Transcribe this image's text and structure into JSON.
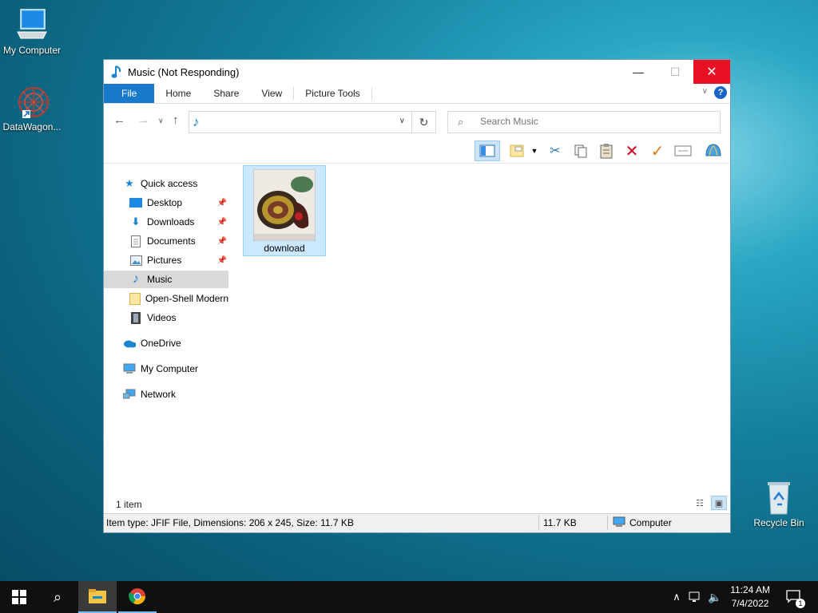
{
  "desktop": {
    "icons": [
      {
        "label": "My Computer"
      },
      {
        "label": "DataWagon..."
      },
      {
        "label": "Recycle Bin"
      }
    ]
  },
  "window": {
    "title": "Music (Not Responding)",
    "controls": {
      "minimize": "—",
      "maximize": "☐",
      "close": "✕"
    },
    "ribbon_tabs": [
      "File",
      "Home",
      "Share",
      "View",
      "Picture Tools"
    ],
    "help": "?",
    "address": {
      "value": ""
    },
    "search": {
      "placeholder": "Search Music"
    },
    "nav_pane": {
      "quick_access": "Quick access",
      "items": [
        {
          "label": "Desktop",
          "pinned": true
        },
        {
          "label": "Downloads",
          "pinned": true
        },
        {
          "label": "Documents",
          "pinned": true
        },
        {
          "label": "Pictures",
          "pinned": true
        },
        {
          "label": "Music",
          "selected": true
        },
        {
          "label": "Open-Shell Modern"
        },
        {
          "label": "Videos"
        }
      ],
      "onedrive": "OneDrive",
      "my_computer": "My Computer",
      "network": "Network"
    },
    "files": [
      {
        "name": "download",
        "selected": true
      }
    ],
    "item_count": "1 item",
    "status_bar": {
      "item_info": "Item type: JFIF File, Dimensions: 206 x 245, Size: 11.7 KB",
      "size": "11.7 KB",
      "location": "Computer"
    }
  },
  "taskbar": {
    "time": "11:24 AM",
    "date": "7/4/2022",
    "notification_count": "1"
  }
}
